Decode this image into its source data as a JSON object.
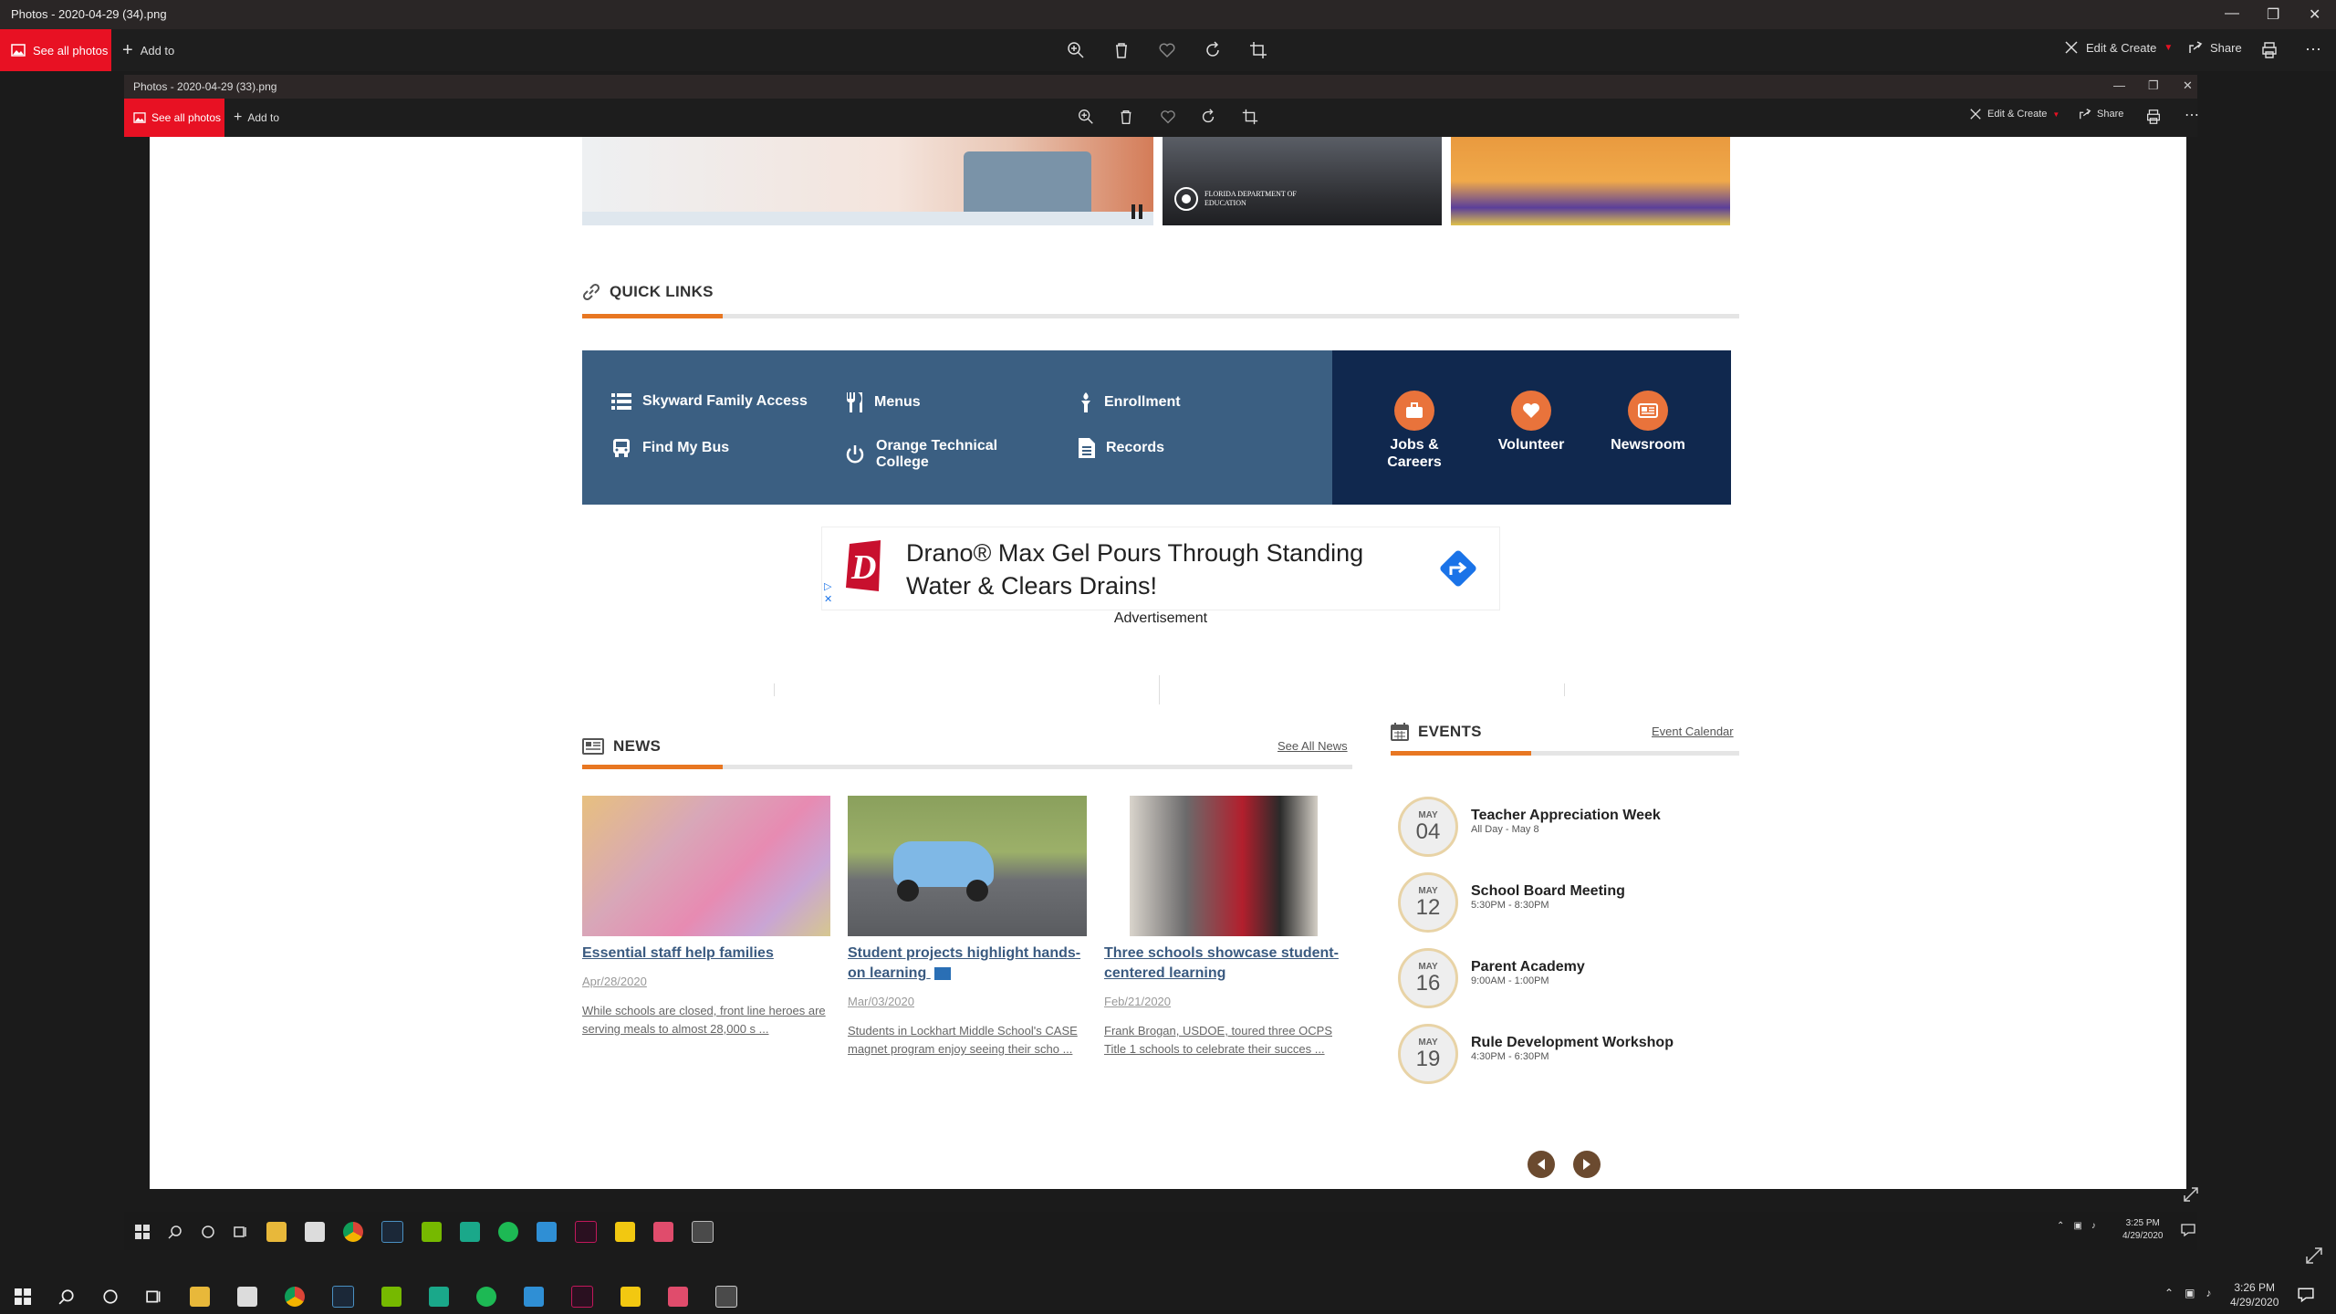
{
  "outer_window": {
    "title": "Photos - 2020-04-29 (34).png",
    "see_all_photos": "See all photos",
    "add_to": "Add to",
    "edit_create": "Edit & Create",
    "share": "Share"
  },
  "inner_window": {
    "title": "Photos - 2020-04-29 (33).png",
    "see_all_photos": "See all photos",
    "add_to": "Add to",
    "edit_create": "Edit & Create",
    "share": "Share"
  },
  "banner": {
    "logo_text": "FLORIDA DEPARTMENT OF EDUCATION"
  },
  "quick_links": {
    "heading": "QUICK LINKS",
    "left_links": [
      {
        "label": "Skyward Family Access",
        "icon": "list-icon"
      },
      {
        "label": "Menus",
        "icon": "utensils-icon"
      },
      {
        "label": "Enrollment",
        "icon": "torch-icon"
      },
      {
        "label": "Find My Bus",
        "icon": "bus-icon"
      },
      {
        "label": "Orange Technical College",
        "icon": "power-icon"
      },
      {
        "label": "Records",
        "icon": "document-icon"
      }
    ],
    "right_links": [
      {
        "label": "Jobs & Careers",
        "icon": "briefcase-icon"
      },
      {
        "label": "Volunteer",
        "icon": "heart-icon"
      },
      {
        "label": "Newsroom",
        "icon": "newspaper-icon"
      }
    ]
  },
  "ad": {
    "text": "Drano® Max Gel Pours Through Standing Water & Clears Drains!",
    "caption": "Advertisement",
    "brand_letter": "D"
  },
  "news": {
    "heading": "NEWS",
    "see_all": "See All News",
    "items": [
      {
        "title": "Essential staff help families",
        "date": "Apr/28/2020",
        "text": "While schools are closed, front line heroes are serving meals to almost 28,000 s ..."
      },
      {
        "title": "Student projects highlight hands-on learning",
        "date": "Mar/03/2020",
        "text": "Students in Lockhart Middle School's CASE magnet program enjoy seeing their scho ..."
      },
      {
        "title": "Three schools showcase student-centered learning",
        "date": "Feb/21/2020",
        "text": "Frank Brogan, USDOE, toured three OCPS Title 1 schools to celebrate their succes ..."
      }
    ]
  },
  "events": {
    "heading": "EVENTS",
    "calendar_link": "Event Calendar",
    "items": [
      {
        "month": "MAY",
        "day": "04",
        "title": "Teacher Appreciation Week",
        "time": "All Day - May 8"
      },
      {
        "month": "MAY",
        "day": "12",
        "title": "School Board Meeting",
        "time": "5:30PM - 8:30PM"
      },
      {
        "month": "MAY",
        "day": "16",
        "title": "Parent Academy",
        "time": "9:00AM - 1:00PM"
      },
      {
        "month": "MAY",
        "day": "19",
        "title": "Rule Development Workshop",
        "time": "4:30PM - 6:30PM"
      }
    ]
  },
  "inner_taskbar": {
    "time": "3:25 PM",
    "date": "4/29/2020"
  },
  "outer_taskbar": {
    "time": "3:26 PM",
    "date": "4/29/2020"
  },
  "colors": {
    "accent_red": "#e81123",
    "orange": "#e87722",
    "ql_blue": "#3b5f82",
    "ql_navy": "#10284e"
  }
}
